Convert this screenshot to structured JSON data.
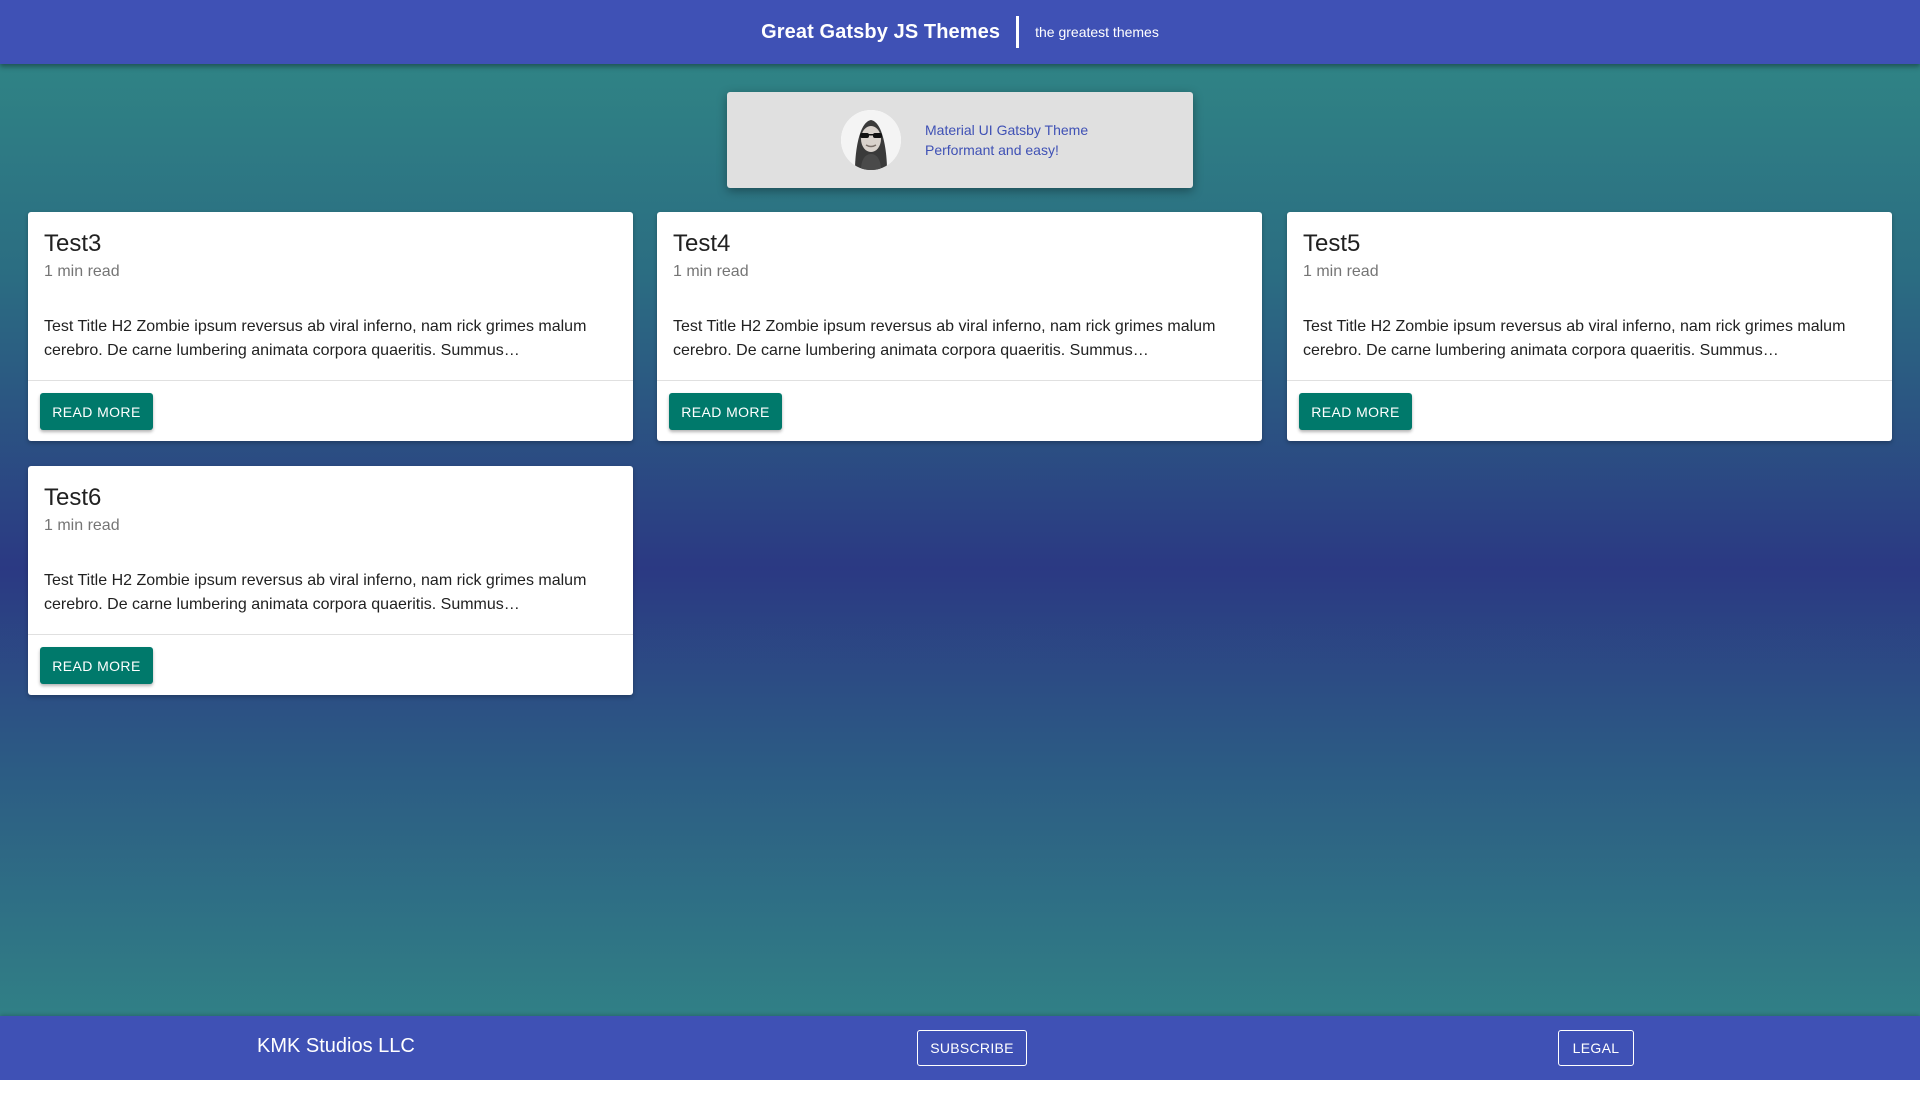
{
  "header": {
    "title": "Great Gatsby JS Themes",
    "tagline": "the greatest themes"
  },
  "profile": {
    "line1": "Material UI Gatsby Theme",
    "line2": "Performant and easy!"
  },
  "posts": [
    {
      "title": "Test3",
      "meta": "1 min read",
      "excerpt": "Test Title H2 Zombie ipsum reversus ab viral inferno, nam rick grimes malum cerebro. De carne lumbering animata corpora quaeritis. Summus…",
      "button": "READ MORE"
    },
    {
      "title": "Test4",
      "meta": "1 min read",
      "excerpt": "Test Title H2 Zombie ipsum reversus ab viral inferno, nam rick grimes malum cerebro. De carne lumbering animata corpora quaeritis. Summus…",
      "button": "READ MORE"
    },
    {
      "title": "Test5",
      "meta": "1 min read",
      "excerpt": "Test Title H2 Zombie ipsum reversus ab viral inferno, nam rick grimes malum cerebro. De carne lumbering animata corpora quaeritis. Summus…",
      "button": "READ MORE"
    },
    {
      "title": "Test6",
      "meta": "1 min read",
      "excerpt": "Test Title H2 Zombie ipsum reversus ab viral inferno, nam rick grimes malum cerebro. De carne lumbering animata corpora quaeritis. Summus…",
      "button": "READ MORE"
    }
  ],
  "footer": {
    "brand": "KMK Studios LLC",
    "subscribe": "SUBSCRIBE",
    "legal": "LEGAL"
  },
  "colors": {
    "primary": "#3f51b5",
    "button": "#00796b",
    "profile_bg": "#e0e0e0"
  }
}
